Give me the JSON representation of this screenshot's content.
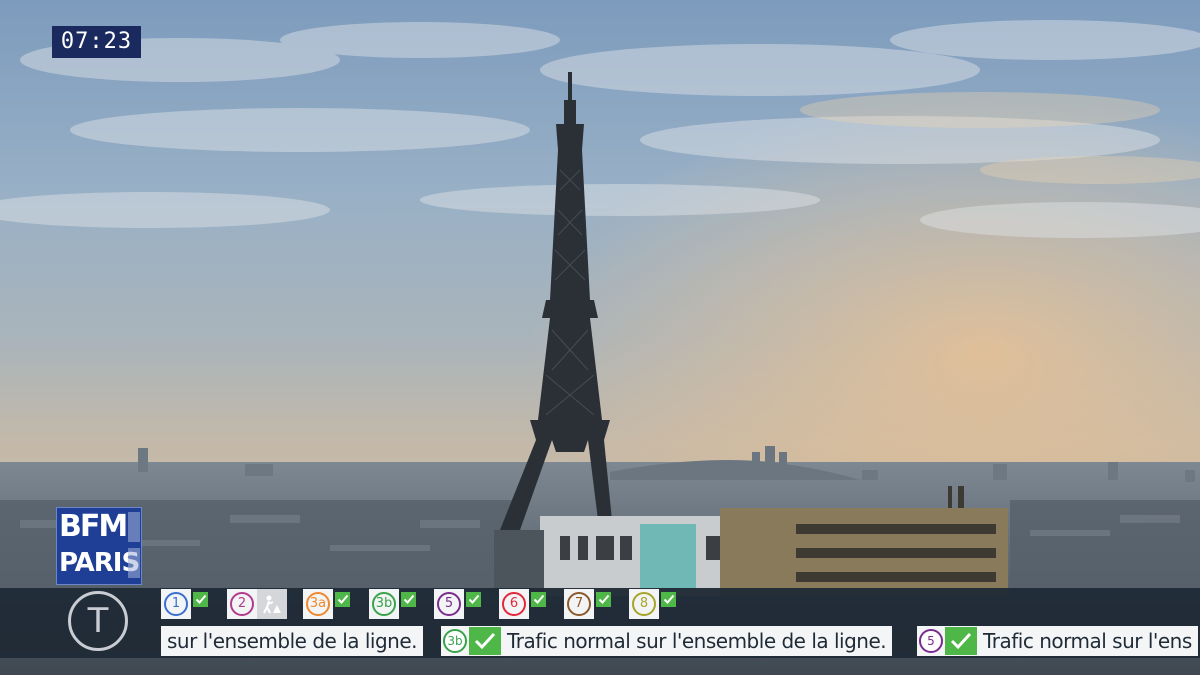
{
  "screen": {
    "clock": "07:23",
    "channel_logo": {
      "line1": "BFM",
      "line2": "PARIS"
    },
    "network_logo_letter": "T"
  },
  "lines": [
    {
      "id": "1",
      "color": "#3a6fd1",
      "status": "ok"
    },
    {
      "id": "2",
      "color": "#b23a8c",
      "status": "works"
    },
    {
      "id": "3a",
      "color": "#f0882e",
      "status": "ok"
    },
    {
      "id": "3b",
      "color": "#3aa34a",
      "status": "ok"
    },
    {
      "id": "5",
      "color": "#7b2c8f",
      "status": "ok"
    },
    {
      "id": "6",
      "color": "#e2283a",
      "status": "ok"
    },
    {
      "id": "7",
      "color": "#8a5a2b",
      "status": "ok"
    },
    {
      "id": "8",
      "color": "#a5a52a",
      "status": "ok"
    }
  ],
  "ticker": {
    "segments": [
      {
        "line": "",
        "line_color": "",
        "text": "sur l'ensemble de la ligne."
      },
      {
        "line": "3b",
        "line_color": "#3aa34a",
        "text": "Trafic normal sur l'ensemble de la ligne."
      },
      {
        "line": "5",
        "line_color": "#7b2c8f",
        "text": "Trafic normal sur l'ens"
      }
    ]
  },
  "colors": {
    "ok_check": "#4fb648",
    "bar_bg": "#1f2b36",
    "logo_bg": "#1f3f97"
  }
}
